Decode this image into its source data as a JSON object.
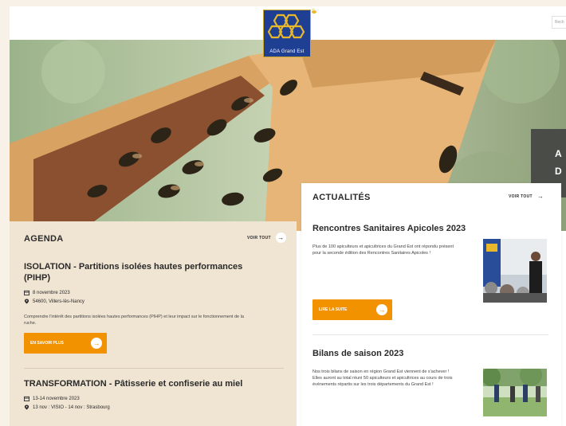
{
  "header": {
    "logo_text": "ADA Grand Est",
    "search_placeholder": "Rech"
  },
  "hero": {
    "slide_text_line1": "A",
    "slide_text_line2": "D"
  },
  "agenda": {
    "title": "AGENDA",
    "see_all": "VOIR TOUT",
    "events": [
      {
        "title": "ISOLATION - Partitions isolées hautes performances (PIHP)",
        "date": "8 novembre 2023",
        "location": "54600, Villers-lès-Nancy",
        "description": "Comprendre l'intérêt des partitions isolées hautes performances (PIHP) et leur impact sur le fonctionnement de la ruche.",
        "button_label": "EN SAVOIR PLUS"
      },
      {
        "title": "TRANSFORMATION - Pâtisserie et confiserie au miel",
        "date": "13-14 novembre 2023",
        "location": "13 nov : VISIO - 14 nov : Strasbourg"
      }
    ]
  },
  "news": {
    "title": "ACTUALITÉS",
    "see_all": "VOIR TOUT",
    "items": [
      {
        "title": "Rencontres Sanitaires Apicoles 2023",
        "description": "Plus de 100 apiculteurs et apicultrices du Grand Est ont répondu présent pour la seconde édition des Rencontres Sanitaires Apicoles !",
        "button_label": "LIRE LA SUITE"
      },
      {
        "title": "Bilans de saison 2023",
        "description": "Nos trois bilans de saison en région Grand Est viennent de s'achever ! Elles auront au total réuni 50 apiculteurs et apicultrices au cours de trois événements répartis sur les trois départements du Grand Est !"
      }
    ]
  },
  "colors": {
    "accent": "#f39200",
    "agenda_bg": "#f0e5d3",
    "logo_blue": "#1f3f92"
  }
}
